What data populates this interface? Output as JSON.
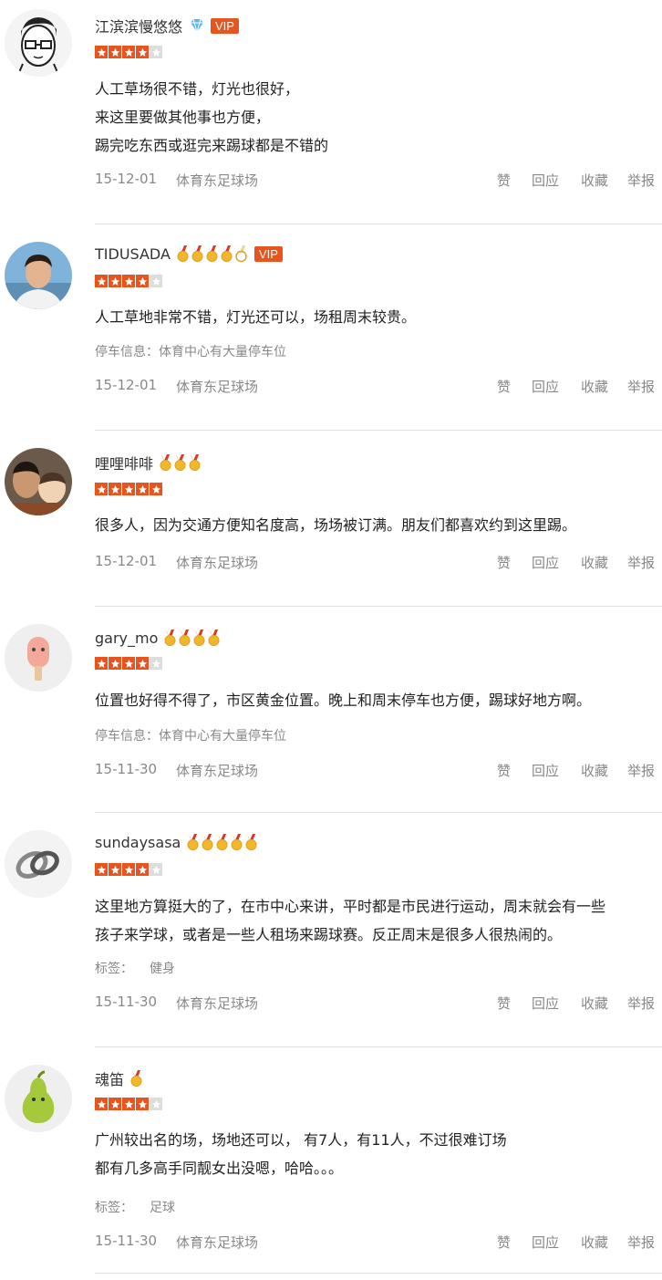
{
  "actions": {
    "like": "赞",
    "reply": "回应",
    "fav": "收藏",
    "report": "举报"
  },
  "reviews": [
    {
      "user": "江滨滨慢悠悠",
      "vip": "VIP",
      "badge": "diamond",
      "medals": 0,
      "rating": 4,
      "lines": [
        "人工草场很不错，灯光也很好，",
        "来这里要做其他事也方便，",
        "踢完吃东西或逛完来踢球都是不错的"
      ],
      "date": "15-12-01",
      "venue": "体育东足球场"
    },
    {
      "user": "TIDUSADA",
      "vip": "VIP",
      "medals": 5,
      "rating": 4,
      "lines": [
        "人工草地非常不错，灯光还可以，场租周末较贵。"
      ],
      "parking_label": "停车信息：",
      "parking": "体育中心有大量停车位",
      "date": "15-12-01",
      "venue": "体育东足球场"
    },
    {
      "user": "哩哩啡啡",
      "medals": 3,
      "rating": 5,
      "lines": [
        "很多人，因为交通方便知名度高，场场被订满。朋友们都喜欢约到这里踢。"
      ],
      "date": "15-12-01",
      "venue": "体育东足球场"
    },
    {
      "user": "gary_mo",
      "medals": 4,
      "rating": 4,
      "lines": [
        "位置也好得不得了，市区黄金位置。晚上和周末停车也方便，踢球好地方啊。"
      ],
      "parking_label": "停车信息：",
      "parking": "体育中心有大量停车位",
      "date": "15-11-30",
      "venue": "体育东足球场"
    },
    {
      "user": "sundaysasa",
      "medals": 5,
      "rating": 4,
      "lines": [
        "这里地方算挺大的了，在市中心来讲，平时都是市民进行运动，周末就会有一些",
        "孩子来学球，或者是一些人租场来踢球赛。反正周末是很多人很热闹的。"
      ],
      "tag_label": "标签：",
      "tag": "健身",
      "date": "15-11-30",
      "venue": "体育东足球场"
    },
    {
      "user": "魂笛",
      "medals": 1,
      "rating": 4,
      "lines": [
        "广州较出名的场，场地还可以， 有7人，有11人，不过很难订场",
        "都有几多高手同靓女出没嗯，哈哈。。。"
      ],
      "tag_label": "标签：",
      "tag": "足球",
      "date": "15-11-30",
      "venue": "体育东足球场"
    }
  ]
}
